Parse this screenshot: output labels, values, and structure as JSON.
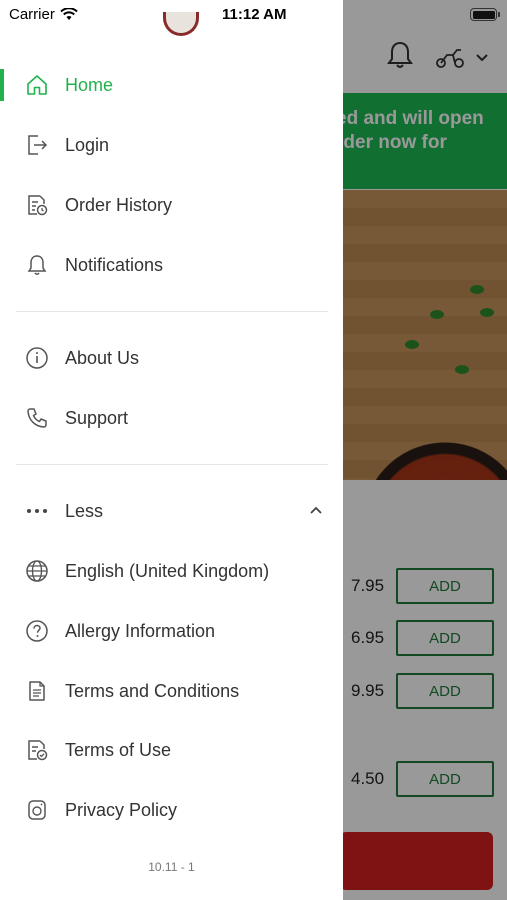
{
  "status_bar": {
    "carrier": "Carrier",
    "time": "11:12 AM"
  },
  "background": {
    "banner_text_line1": "ed and will open",
    "banner_text_line2": "rder now for",
    "banner_color": "#1db954",
    "items": [
      {
        "price": "7.95",
        "add_label": "ADD"
      },
      {
        "price": "6.95",
        "add_label": "ADD"
      },
      {
        "price": "9.95",
        "add_label": "ADD"
      },
      {
        "price": "4.50",
        "add_label": "ADD"
      }
    ]
  },
  "drawer": {
    "accent_color": "#22b14c",
    "primary_items": [
      {
        "label": "Home",
        "icon": "home-icon",
        "active": true
      },
      {
        "label": "Login",
        "icon": "login-icon"
      },
      {
        "label": "Order History",
        "icon": "order-history-icon"
      },
      {
        "label": "Notifications",
        "icon": "bell-icon"
      }
    ],
    "secondary_items": [
      {
        "label": "About Us",
        "icon": "info-icon"
      },
      {
        "label": "Support",
        "icon": "phone-icon"
      }
    ],
    "less_toggle": {
      "label": "Less",
      "icon": "more-dots-icon"
    },
    "more_items": [
      {
        "label": "English (United Kingdom)",
        "icon": "globe-icon"
      },
      {
        "label": "Allergy Information",
        "icon": "question-icon"
      },
      {
        "label": "Terms and Conditions",
        "icon": "document-icon"
      },
      {
        "label": "Terms of Use",
        "icon": "document-check-icon"
      },
      {
        "label": "Privacy Policy",
        "icon": "privacy-icon"
      }
    ],
    "version": "10.11 - 1"
  }
}
